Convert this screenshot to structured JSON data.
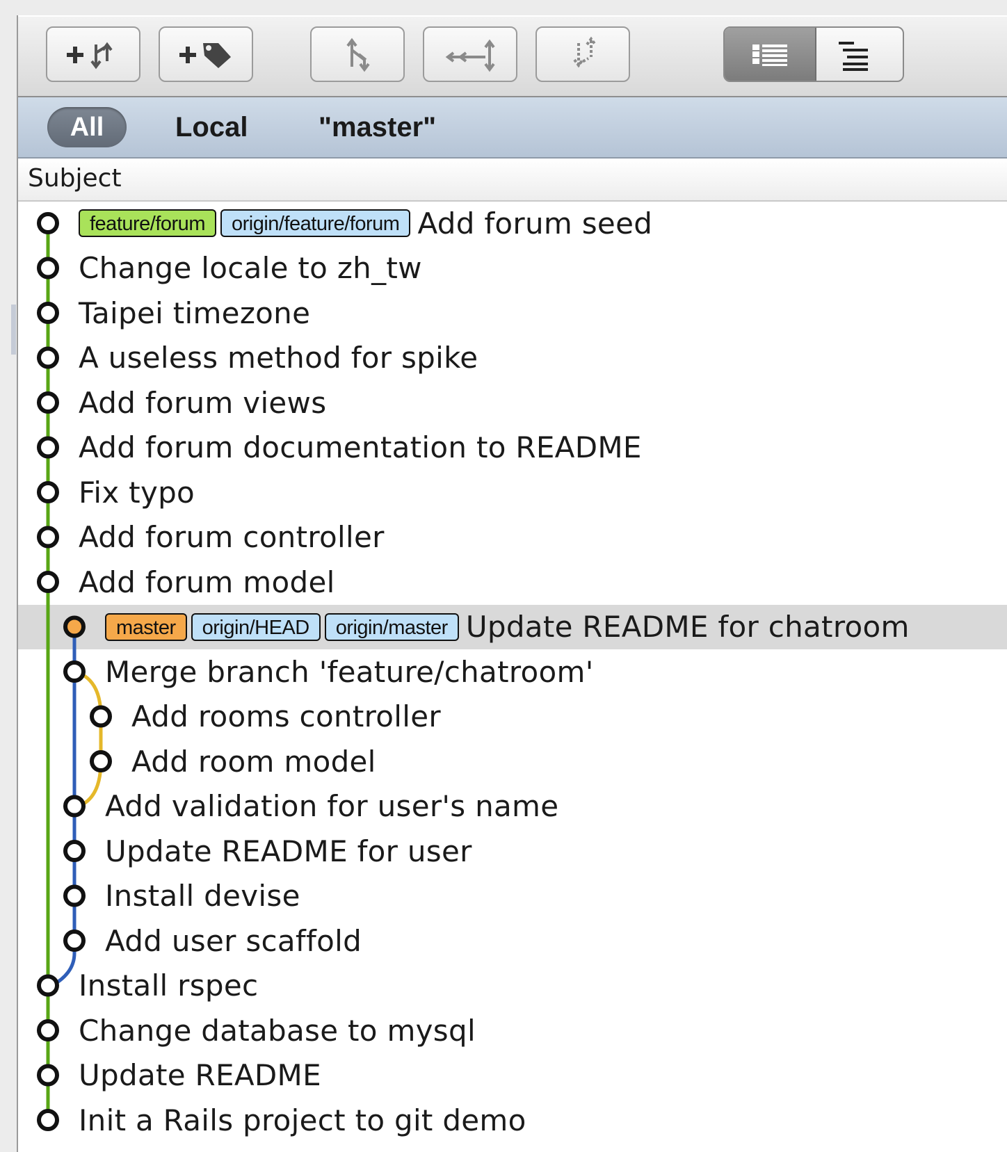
{
  "scope_bar": {
    "all": "All",
    "local": "Local",
    "branch": "\"master\""
  },
  "columns": {
    "subject": "Subject"
  },
  "toolbar_icons": [
    "add-branch-icon",
    "add-tag-icon",
    "checkout-icon",
    "merge-icon",
    "rebase-icon",
    "detailed-list-icon",
    "compact-list-icon"
  ],
  "colors": {
    "local_branch": "#a9e25a",
    "remote_branch": "#bfe0f8",
    "head_branch": "#f5a84a",
    "lane_main": "#58a615",
    "lane_branch": "#2f5eb8",
    "lane_merge": "#e5b82a"
  },
  "commits": [
    {
      "subject": "Add forum seed",
      "labels": [
        {
          "text": "feature/forum",
          "kind": "local"
        },
        {
          "text": "origin/feature/forum",
          "kind": "remote"
        }
      ]
    },
    {
      "subject": "Change locale to zh_tw",
      "labels": []
    },
    {
      "subject": "Taipei timezone",
      "labels": []
    },
    {
      "subject": "A useless method for spike",
      "labels": []
    },
    {
      "subject": "Add forum views",
      "labels": []
    },
    {
      "subject": "Add forum documentation to README",
      "labels": []
    },
    {
      "subject": "Fix typo",
      "labels": []
    },
    {
      "subject": "Add forum controller",
      "labels": []
    },
    {
      "subject": "Add forum model",
      "labels": []
    },
    {
      "subject": "Update README for chatroom",
      "selected": true,
      "labels": [
        {
          "text": "master",
          "kind": "head"
        },
        {
          "text": "origin/HEAD",
          "kind": "remote"
        },
        {
          "text": "origin/master",
          "kind": "remote"
        }
      ]
    },
    {
      "subject": "Merge branch 'feature/chatroom'",
      "labels": []
    },
    {
      "subject": "Add rooms controller",
      "labels": []
    },
    {
      "subject": "Add room model",
      "labels": []
    },
    {
      "subject": "Add validation for user's name",
      "labels": []
    },
    {
      "subject": "Update README for user",
      "labels": []
    },
    {
      "subject": "Install devise",
      "labels": []
    },
    {
      "subject": "Add user scaffold",
      "labels": []
    },
    {
      "subject": "Install rspec",
      "labels": []
    },
    {
      "subject": "Change database to mysql",
      "labels": []
    },
    {
      "subject": "Update README",
      "labels": []
    },
    {
      "subject": "Init a Rails project to git demo",
      "labels": []
    }
  ]
}
